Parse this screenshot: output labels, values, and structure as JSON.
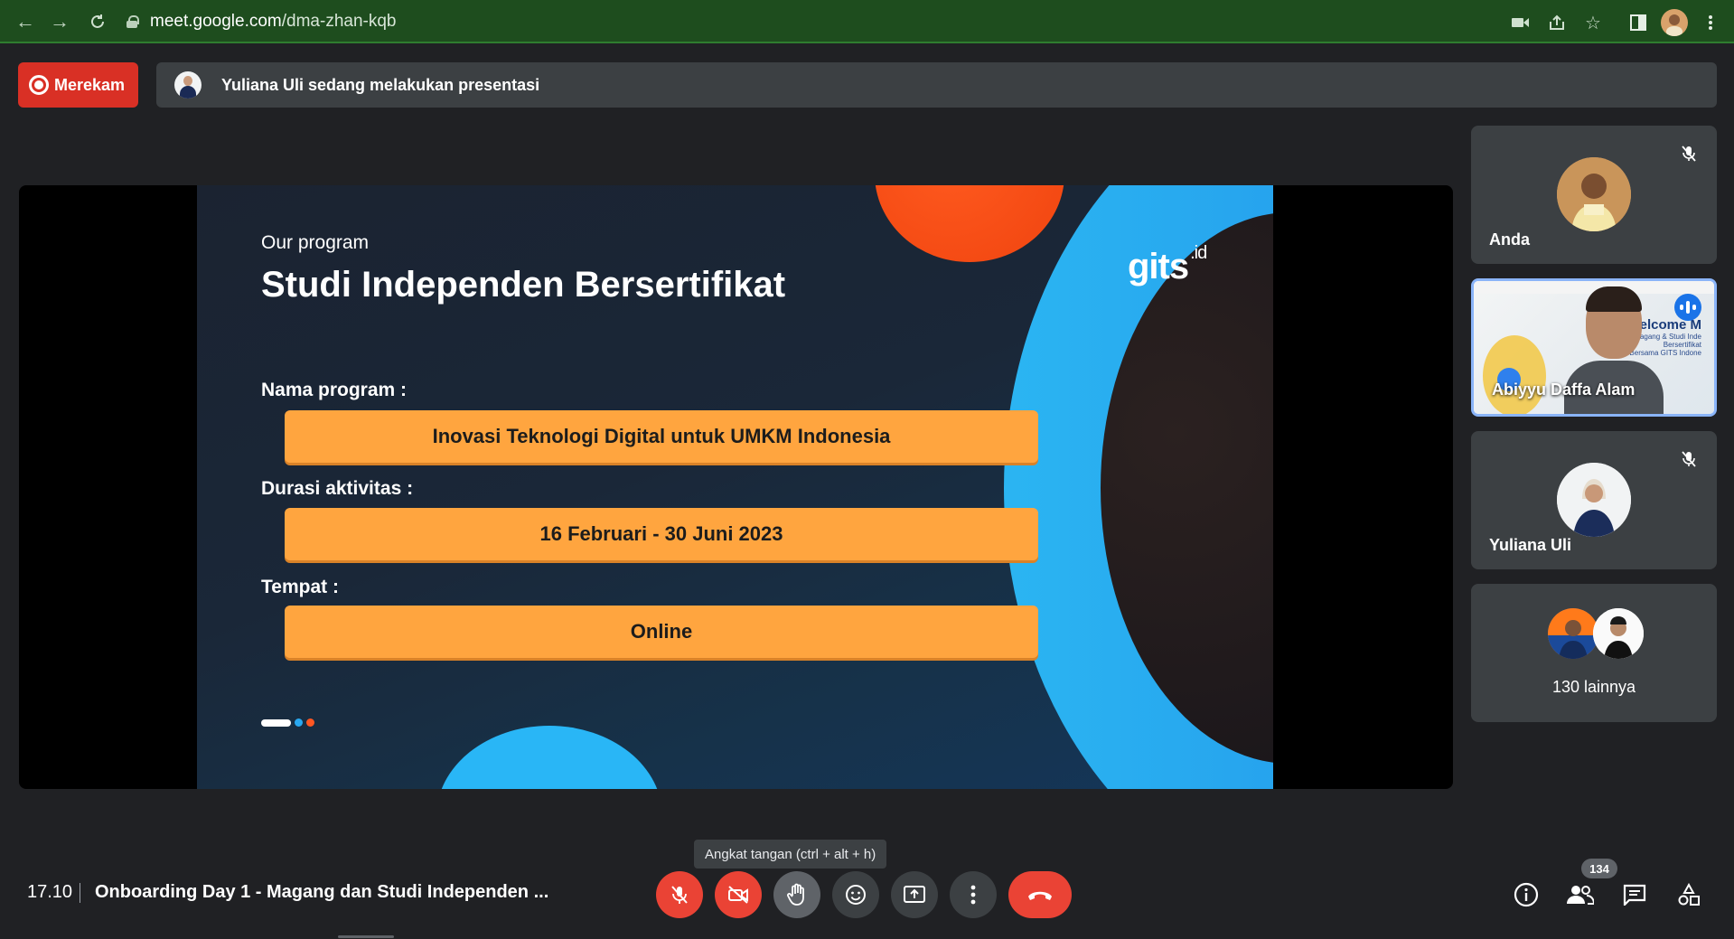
{
  "browser": {
    "url_host": "meet.google.com",
    "url_path": "/dma-zhan-kqb"
  },
  "recording": {
    "label": "Merekam"
  },
  "presenting_banner": {
    "text": "Yuliana Uli sedang melakukan presentasi"
  },
  "slide": {
    "kicker": "Our program",
    "title": "Studi Independen Bersertifikat",
    "logo_text": "gits",
    "logo_sup": ".id",
    "fields": [
      {
        "label": "Nama program :",
        "value": "Inovasi Teknologi Digital untuk UMKM Indonesia"
      },
      {
        "label": "Durasi aktivitas :",
        "value": "16 Februari - 30 Juni 2023"
      },
      {
        "label": "Tempat :",
        "value": "Online"
      }
    ],
    "colors": {
      "orange": "#ffa53f",
      "blue": "#2bb5f2",
      "accent_orange": "#ff5a1f"
    }
  },
  "participants": [
    {
      "name": "Anda",
      "muted": true
    },
    {
      "name": "Abiyyu Daffa Alam",
      "speaking": true,
      "poster_title": "Welcome M",
      "poster_lines": [
        "Magang & Studi Inde",
        "Bersertifikat",
        "Bersama GITS Indone"
      ]
    },
    {
      "name": "Yuliana Uli",
      "muted": true
    },
    {
      "name": "130 lainnya"
    }
  ],
  "bottom": {
    "time": "17.10",
    "meeting_title": "Onboarding Day 1 - Magang dan Studi Independen ...",
    "tooltip": "Angkat tangan (ctrl + alt + h)",
    "people_count": "134"
  },
  "icons": [
    "back-icon",
    "forward-icon",
    "reload-icon",
    "lock-icon",
    "camera-icon",
    "share-icon",
    "star-icon",
    "sidepanel-icon",
    "profile-icon",
    "menu-icon",
    "record-icon",
    "mic-off-icon",
    "cam-off-icon",
    "hand-icon",
    "emoji-icon",
    "present-icon",
    "more-icon",
    "end-call-icon",
    "info-icon",
    "people-icon",
    "chat-icon",
    "activities-icon"
  ]
}
